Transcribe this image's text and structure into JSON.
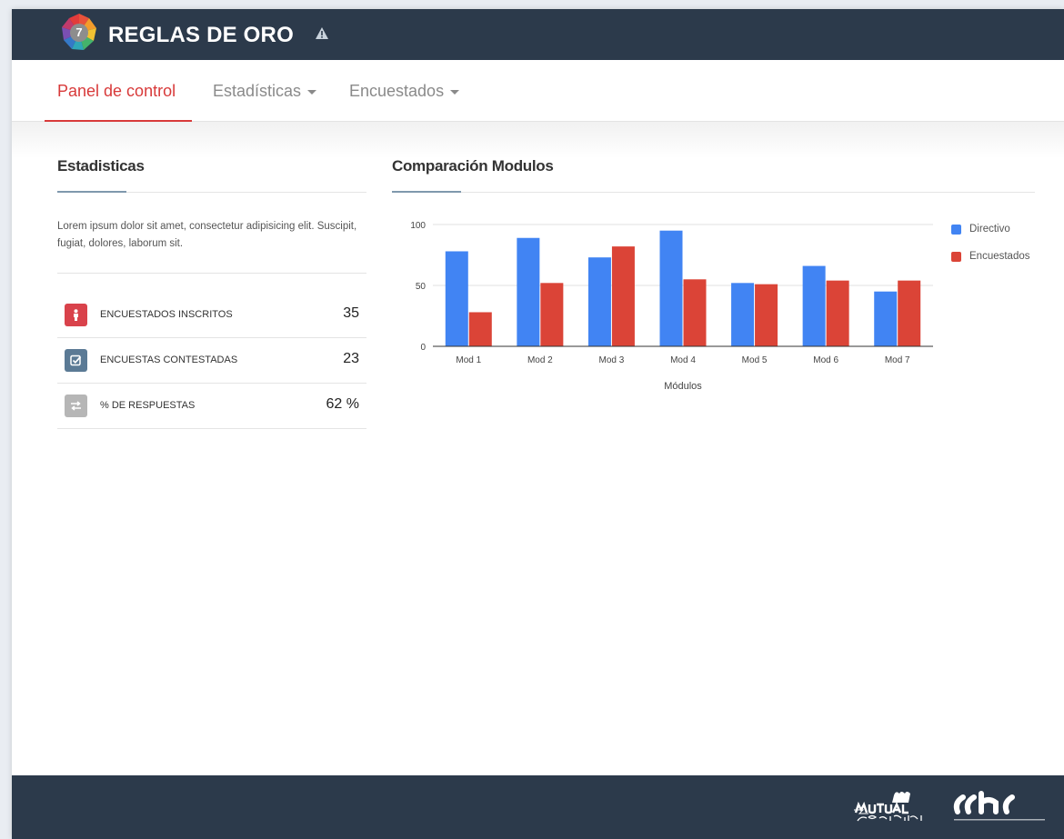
{
  "header": {
    "brand": "REGLAS DE ORO",
    "badge_number": "7",
    "warning_icon": "warning-icon"
  },
  "nav": {
    "items": [
      {
        "label": "Panel de control",
        "active": true,
        "has_caret": false
      },
      {
        "label": "Estadísticas",
        "active": false,
        "has_caret": true
      },
      {
        "label": "Encuestados",
        "active": false,
        "has_caret": true
      }
    ],
    "active_color": "#d83a3a"
  },
  "stats_panel": {
    "title": "Estadisticas",
    "description": "Lorem ipsum dolor sit amet, consectetur adipisicing elit. Suscipit, fugiat, dolores, laborum sit.",
    "rows": [
      {
        "label": "ENCUESTADOS INSCRITOS",
        "value": "35",
        "icon": "person-icon",
        "color": "#d9424b"
      },
      {
        "label": "ENCUESTAS CONTESTADAS",
        "value": "23",
        "icon": "checkbox-icon",
        "color": "#5b7a95"
      },
      {
        "label": "% DE RESPUESTAS",
        "value": "62 %",
        "icon": "exchange-icon",
        "color": "#b6b6b6"
      }
    ]
  },
  "chart_panel": {
    "title": "Comparación Modulos"
  },
  "chart_data": {
    "type": "bar",
    "categories": [
      "Mod 1",
      "Mod 2",
      "Mod 3",
      "Mod 4",
      "Mod 5",
      "Mod 6",
      "Mod 7"
    ],
    "series": [
      {
        "name": "Directivo",
        "color": "#4184f3",
        "values": [
          78,
          89,
          73,
          95,
          52,
          66,
          45
        ]
      },
      {
        "name": "Encuestados",
        "color": "#db4437",
        "values": [
          28,
          52,
          82,
          55,
          51,
          54,
          54
        ]
      }
    ],
    "xlabel": "Módulos",
    "ylabel": "",
    "ylim": [
      0,
      100
    ],
    "yticks": [
      "0",
      "50",
      "100"
    ],
    "grid": true,
    "legend": "right"
  },
  "footer": {
    "logos": [
      "mutual-de-seguridad-logo",
      "cchc-logo"
    ]
  }
}
